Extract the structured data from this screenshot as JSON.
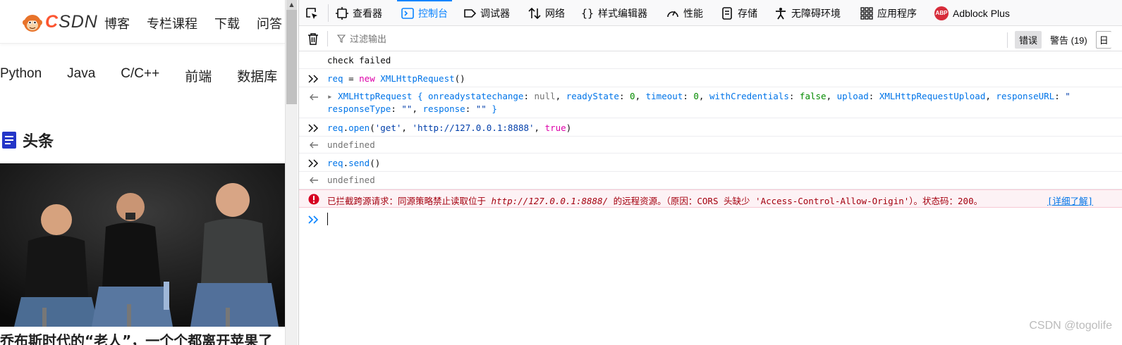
{
  "page": {
    "logo_text": "CSDN",
    "top_nav": [
      "博客",
      "专栏课程",
      "下载",
      "问答"
    ],
    "category_nav": [
      "Python",
      "Java",
      "C/C++",
      "前端",
      "数据库"
    ],
    "section_title": "头条",
    "article_caption": "乔布斯时代的“老人”，一个个都离开苹果了"
  },
  "devtools": {
    "tabs": [
      {
        "label": "查看器",
        "icon": "inspector-icon"
      },
      {
        "label": "控制台",
        "icon": "console-icon",
        "active": true
      },
      {
        "label": "调试器",
        "icon": "debugger-icon"
      },
      {
        "label": "网络",
        "icon": "network-icon"
      },
      {
        "label": "样式编辑器",
        "icon": "style-editor-icon"
      },
      {
        "label": "性能",
        "icon": "performance-icon"
      },
      {
        "label": "存储",
        "icon": "storage-icon"
      },
      {
        "label": "无障碍环境",
        "icon": "accessibility-icon"
      },
      {
        "label": "应用程序",
        "icon": "application-icon"
      },
      {
        "label": "Adblock Plus",
        "icon": "adblock-plus-icon"
      }
    ],
    "filter_placeholder": "过滤输出",
    "filter_buttons": {
      "errors": "错误",
      "warnings": "警告 (19)",
      "logs_cut": "日"
    },
    "colors": {
      "accent": "#0a84ff",
      "error_text": "#a4000f",
      "error_bg": "#fdf2f5"
    }
  },
  "console": {
    "lines": {
      "check_failed": "check failed",
      "in1_var": "req",
      "in1_eq": " = ",
      "in1_new": "new",
      "in1_ctor": "XMLHttpRequest",
      "in1_paren": "()",
      "out1_name": "XMLHttpRequest",
      "out1_l1a": " { ",
      "out1_k1": "onreadystatechange",
      "out1_v1": "null",
      "out1_k2": "readyState",
      "out1_v2": "0",
      "out1_k3": "timeout",
      "out1_v3": "0",
      "out1_k4": "withCredentials",
      "out1_v4": "false",
      "out1_k5": "upload",
      "out1_v5": "XMLHttpRequestUpload",
      "out1_k6": "responseURL",
      "out1_v6": "\"",
      "out1_k7": "responseType",
      "out1_v7": "\"\"",
      "out1_k8": "response",
      "out1_v8": "\"\"",
      "out1_end": " }",
      "in2_obj": "req",
      "in2_method": "open",
      "in2_a1": "'get'",
      "in2_a2": "'http://127.0.0.1:8888'",
      "in2_a3": "true",
      "out2": "undefined",
      "in3_obj": "req",
      "in3_method": "send",
      "out3": "undefined",
      "err_prefix": "已拦截跨源请求：同源策略禁止读取位于 ",
      "err_url": "http://127.0.0.1:8888/",
      "err_suffix": " 的远程资源。（原因：CORS 头缺少 'Access-Control-Allow-Origin'）。状态码：200。",
      "err_learn_more": "[详细了解]"
    }
  },
  "watermark": "CSDN @togolife"
}
